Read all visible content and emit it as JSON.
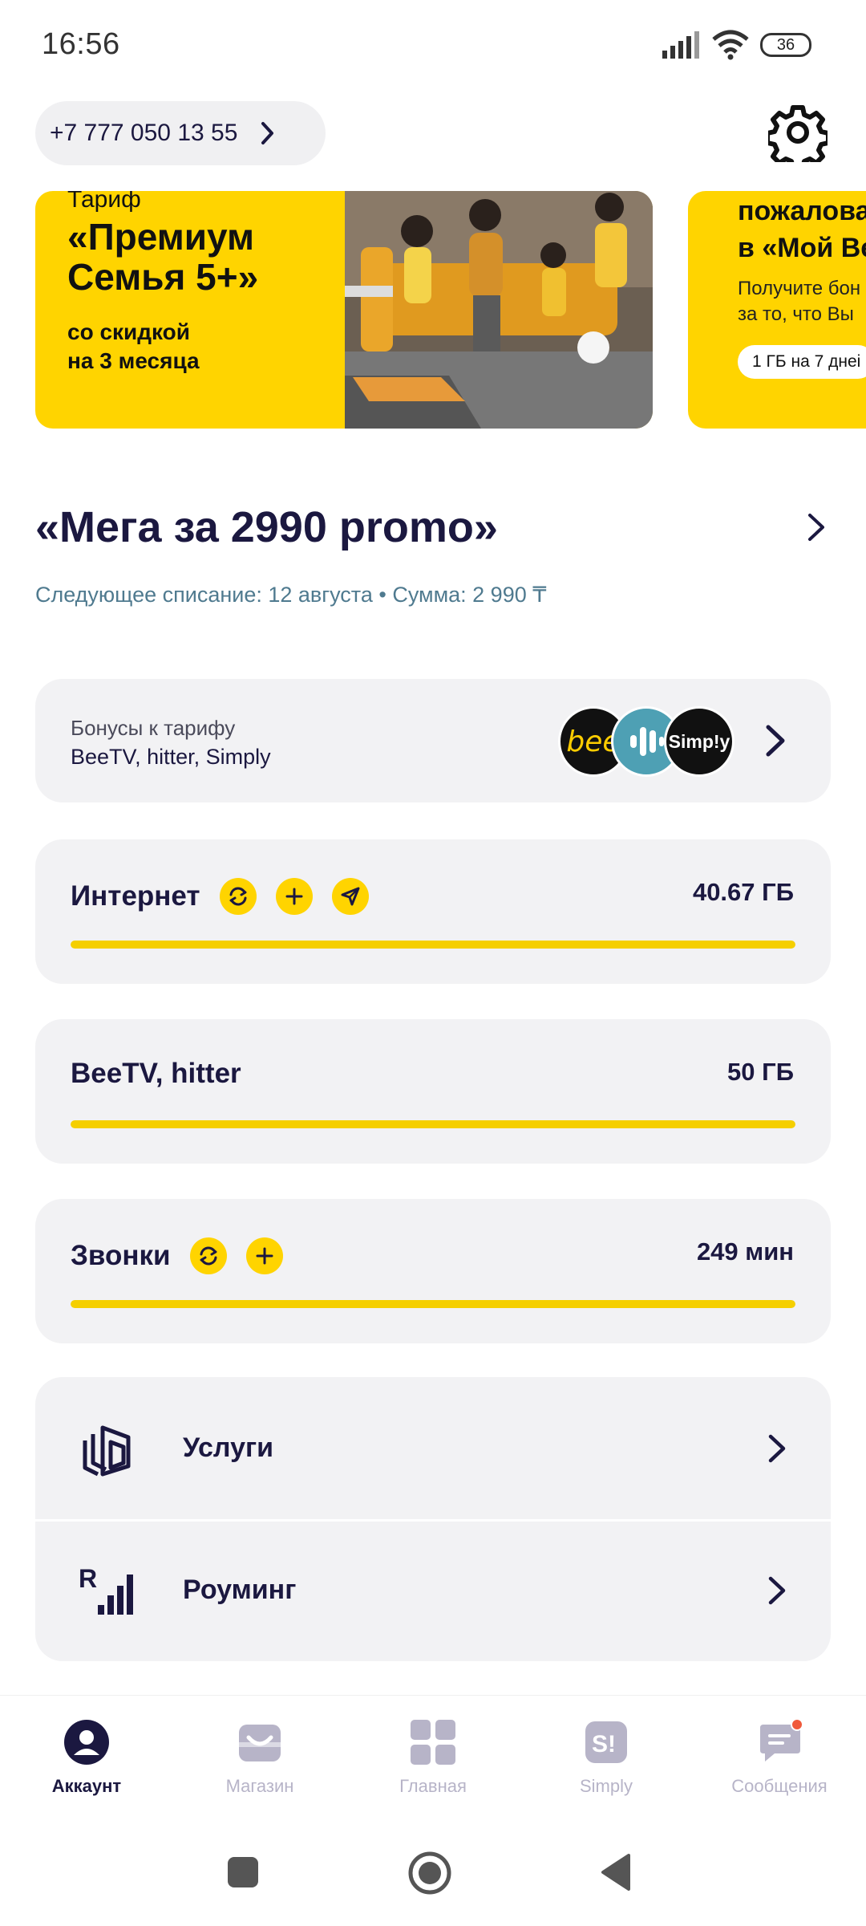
{
  "status_bar": {
    "time": "16:56",
    "battery": "36",
    "icons": [
      "signal-icon",
      "wifi-icon",
      "battery-icon"
    ]
  },
  "header": {
    "phone_number": "+7 777 050 13 55",
    "icons": [
      "chevron-right-icon",
      "gear-icon"
    ]
  },
  "banners": [
    {
      "kicker": "Тариф",
      "headline_line1": "«Премиум",
      "headline_line2": "Семья 5+»",
      "sub_line1": "со скидкой",
      "sub_line2": "на 3 месяца"
    },
    {
      "headline_line1": "пожалова",
      "headline_line2": "в «Мой Be",
      "text_line1": "Получите бон",
      "text_line2": "за то, что Вы",
      "chip": "1 ГБ на 7 днеі"
    }
  ],
  "tariff": {
    "title": "«Мега за 2990 promo»",
    "next_charge": "Следующее списание: 12 августа • Сумма: 2 990 ₸"
  },
  "bonuses": {
    "label": "Бонусы к тарифу",
    "value": "BeeTV, hitter, Simply",
    "logos": {
      "bee": "bee",
      "simply": "Simp!y"
    }
  },
  "usage": [
    {
      "title": "Интернет",
      "amount": "40.67 ГБ",
      "fill": 1.0,
      "actions": [
        "refresh-icon",
        "plus-icon",
        "send-icon"
      ]
    },
    {
      "title": "BeeTV, hitter",
      "amount": "50 ГБ",
      "fill": 1.0,
      "actions": []
    },
    {
      "title": "Звонки",
      "amount": "249 мин",
      "fill": 1.0,
      "actions": [
        "refresh-icon",
        "plus-icon"
      ]
    }
  ],
  "menu": [
    {
      "label": "Услуги",
      "icon": "services-icon"
    },
    {
      "label": "Роуминг",
      "icon": "roaming-icon"
    }
  ],
  "bottom_nav": [
    {
      "label": "Аккаунт",
      "icon": "account-icon",
      "active": true
    },
    {
      "label": "Магазин",
      "icon": "shop-icon",
      "active": false
    },
    {
      "label": "Главная",
      "icon": "home-grid-icon",
      "active": false
    },
    {
      "label": "Simply",
      "icon": "simply-icon",
      "active": false
    },
    {
      "label": "Сообщения",
      "icon": "messages-icon",
      "active": false
    }
  ],
  "colors": {
    "accent_yellow": "#ffd400",
    "text_dark": "#1b1840",
    "info_text": "#4f7a8f",
    "card_bg": "#f2f2f4",
    "nav_inactive": "#b7b4c8",
    "notification_dot": "#f05a3c"
  }
}
